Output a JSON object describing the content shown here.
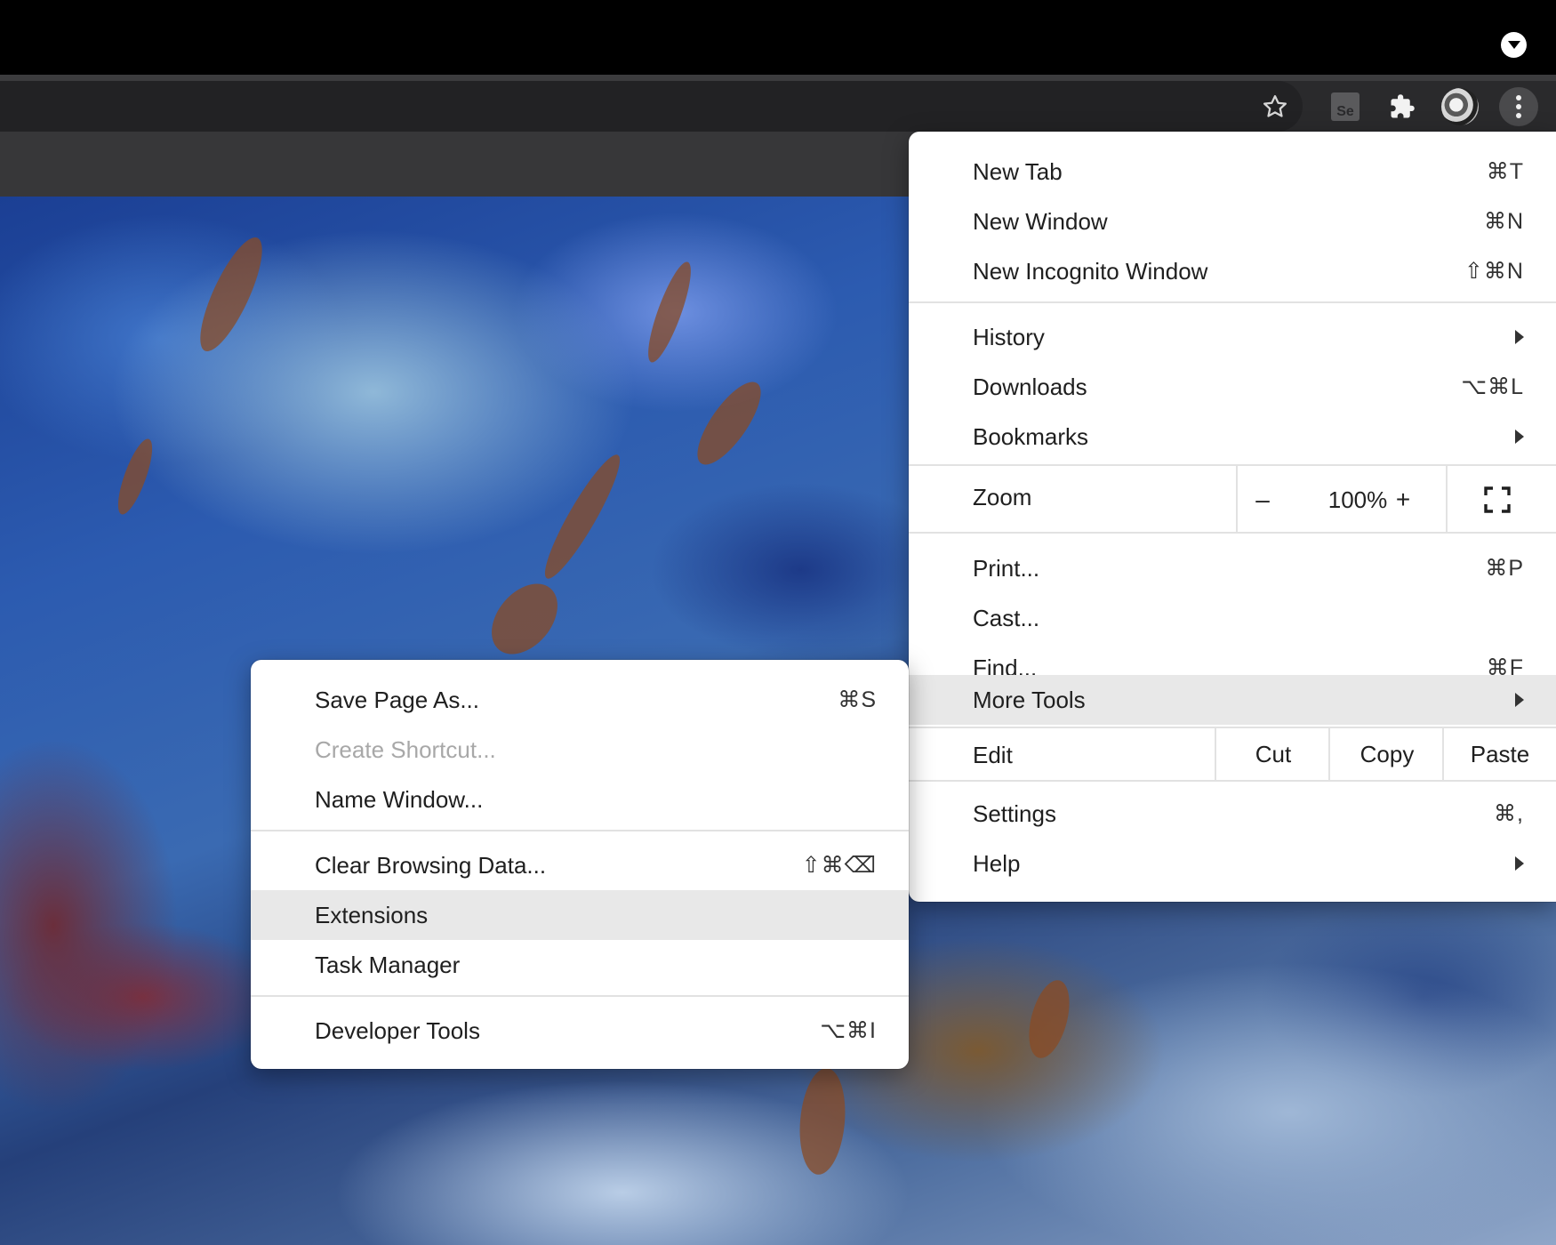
{
  "toolbar": {
    "extension_label": "Se"
  },
  "zoom_level": "100%",
  "main_menu": {
    "items": [
      {
        "label": "New Tab",
        "shortcut": "⌘T"
      },
      {
        "label": "New Window",
        "shortcut": "⌘N"
      },
      {
        "label": "New Incognito Window",
        "shortcut": "⇧⌘N"
      },
      {
        "label": "History",
        "shortcut": ""
      },
      {
        "label": "Downloads",
        "shortcut": "⌥⌘L"
      },
      {
        "label": "Bookmarks",
        "shortcut": ""
      },
      {
        "label": "Print...",
        "shortcut": "⌘P"
      },
      {
        "label": "Cast...",
        "shortcut": ""
      },
      {
        "label": "Find...",
        "shortcut": "⌘F"
      },
      {
        "label": "More Tools",
        "shortcut": ""
      },
      {
        "label": "Settings",
        "shortcut": "⌘,"
      },
      {
        "label": "Help",
        "shortcut": ""
      }
    ],
    "zoom": {
      "label": "Zoom",
      "minus": "–",
      "value": "100%",
      "plus": "+"
    },
    "edit": {
      "label": "Edit",
      "cut": "Cut",
      "copy": "Copy",
      "paste": "Paste"
    }
  },
  "submenu": {
    "items": [
      {
        "label": "Save Page As...",
        "shortcut": "⌘S"
      },
      {
        "label": "Create Shortcut...",
        "shortcut": "",
        "disabled": true
      },
      {
        "label": "Name Window...",
        "shortcut": ""
      },
      {
        "label": "Clear Browsing Data...",
        "shortcut": "⇧⌘⌫"
      },
      {
        "label": "Extensions",
        "shortcut": ""
      },
      {
        "label": "Task Manager",
        "shortcut": ""
      },
      {
        "label": "Developer Tools",
        "shortcut": "⌥⌘I"
      }
    ]
  },
  "colors": {
    "menu_bg": "#ffffff",
    "highlight": "#e8e8e8",
    "toolbar": "#2a2a2c",
    "disabled_text": "#a8a8a8"
  }
}
